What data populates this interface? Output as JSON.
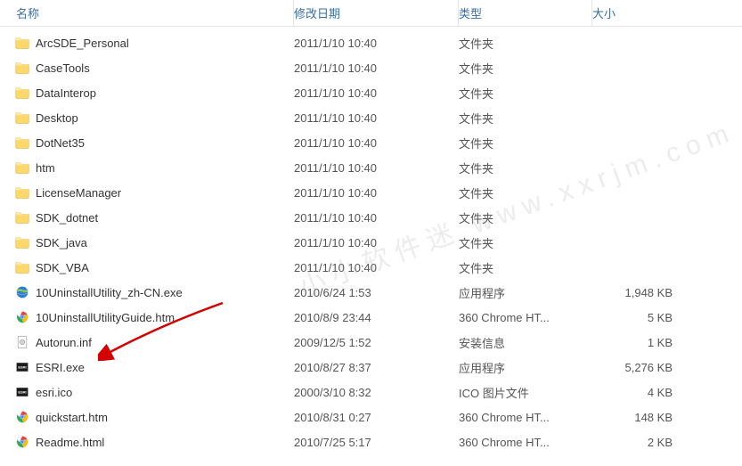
{
  "columns": {
    "name": "名称",
    "date": "修改日期",
    "type": "类型",
    "size": "大小"
  },
  "files": [
    {
      "name": "ArcSDE_Personal",
      "date": "2011/1/10 10:40",
      "type": "文件夹",
      "size": "",
      "icon": "folder"
    },
    {
      "name": "CaseTools",
      "date": "2011/1/10 10:40",
      "type": "文件夹",
      "size": "",
      "icon": "folder"
    },
    {
      "name": "DataInterop",
      "date": "2011/1/10 10:40",
      "type": "文件夹",
      "size": "",
      "icon": "folder"
    },
    {
      "name": "Desktop",
      "date": "2011/1/10 10:40",
      "type": "文件夹",
      "size": "",
      "icon": "folder"
    },
    {
      "name": "DotNet35",
      "date": "2011/1/10 10:40",
      "type": "文件夹",
      "size": "",
      "icon": "folder"
    },
    {
      "name": "htm",
      "date": "2011/1/10 10:40",
      "type": "文件夹",
      "size": "",
      "icon": "folder"
    },
    {
      "name": "LicenseManager",
      "date": "2011/1/10 10:40",
      "type": "文件夹",
      "size": "",
      "icon": "folder"
    },
    {
      "name": "SDK_dotnet",
      "date": "2011/1/10 10:40",
      "type": "文件夹",
      "size": "",
      "icon": "folder"
    },
    {
      "name": "SDK_java",
      "date": "2011/1/10 10:40",
      "type": "文件夹",
      "size": "",
      "icon": "folder"
    },
    {
      "name": "SDK_VBA",
      "date": "2011/1/10 10:40",
      "type": "文件夹",
      "size": "",
      "icon": "folder"
    },
    {
      "name": "10UninstallUtility_zh-CN.exe",
      "date": "2010/6/24 1:53",
      "type": "应用程序",
      "size": "1,948 KB",
      "icon": "globe"
    },
    {
      "name": "10UninstallUtilityGuide.htm",
      "date": "2010/8/9 23:44",
      "type": "360 Chrome HT...",
      "size": "5 KB",
      "icon": "chrome"
    },
    {
      "name": "Autorun.inf",
      "date": "2009/12/5 1:52",
      "type": "安装信息",
      "size": "1 KB",
      "icon": "inf"
    },
    {
      "name": "ESRI.exe",
      "date": "2010/8/27 8:37",
      "type": "应用程序",
      "size": "5,276 KB",
      "icon": "esri"
    },
    {
      "name": "esri.ico",
      "date": "2000/3/10 8:32",
      "type": "ICO 图片文件",
      "size": "4 KB",
      "icon": "esri"
    },
    {
      "name": "quickstart.htm",
      "date": "2010/8/31 0:27",
      "type": "360 Chrome HT...",
      "size": "148 KB",
      "icon": "chrome"
    },
    {
      "name": "Readme.html",
      "date": "2010/7/25 5:17",
      "type": "360 Chrome HT...",
      "size": "2 KB",
      "icon": "chrome"
    }
  ],
  "watermark": "小小软件迷 www.xxrjm.com"
}
